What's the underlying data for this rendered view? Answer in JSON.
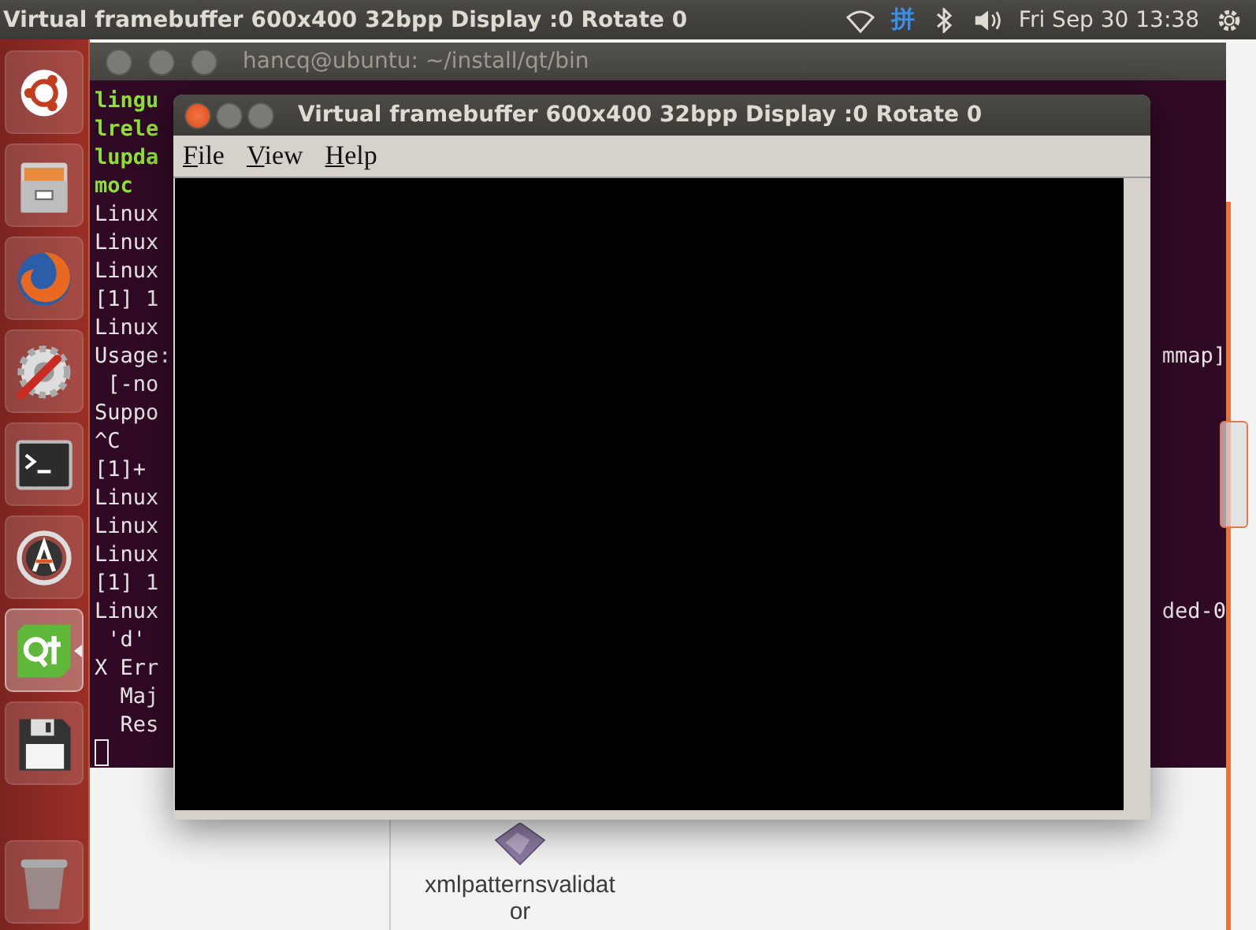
{
  "top_bar": {
    "title": "Virtual framebuffer 600x400 32bpp Display :0 Rotate 0",
    "input_method": "拼",
    "clock": "Fri Sep 30 13:38"
  },
  "launcher": {
    "items": [
      {
        "kind": "ubuntu",
        "selected": false
      },
      {
        "kind": "files",
        "selected": false
      },
      {
        "kind": "firefox",
        "selected": false
      },
      {
        "kind": "settings",
        "selected": false
      },
      {
        "kind": "terminal",
        "selected": false
      },
      {
        "kind": "updater",
        "selected": false
      },
      {
        "kind": "qt",
        "selected": true
      },
      {
        "kind": "save",
        "selected": false
      },
      {
        "kind": "trash",
        "selected": false
      }
    ]
  },
  "terminal": {
    "title": "hancq@ubuntu: ~/install/qt/bin",
    "lines": [
      {
        "kind": "executable",
        "text": "lingu"
      },
      {
        "kind": "executable",
        "text": "lrele"
      },
      {
        "kind": "executable",
        "text": "lupda"
      },
      {
        "kind": "executable",
        "text": "moc"
      },
      {
        "kind": "output",
        "text": "Linux"
      },
      {
        "kind": "output",
        "text": "Linux"
      },
      {
        "kind": "output",
        "text": "Linux"
      },
      {
        "kind": "output",
        "text": "[1] 1"
      },
      {
        "kind": "output",
        "text": "Linux"
      },
      {
        "kind": "output",
        "text": "Usage:",
        "right": "mmap]"
      },
      {
        "kind": "output",
        "text": " [-no"
      },
      {
        "kind": "output",
        "text": "Suppo"
      },
      {
        "kind": "output",
        "text": "^C"
      },
      {
        "kind": "output",
        "text": "[1]+"
      },
      {
        "kind": "output",
        "text": "Linux"
      },
      {
        "kind": "output",
        "text": "Linux"
      },
      {
        "kind": "output",
        "text": "Linux"
      },
      {
        "kind": "output",
        "text": "[1] 1"
      },
      {
        "kind": "output",
        "text": "Linux",
        "right": "ded-0"
      },
      {
        "kind": "output",
        "text": " 'd'"
      },
      {
        "kind": "output",
        "text": "X Err"
      },
      {
        "kind": "output",
        "text": "  Maj"
      },
      {
        "kind": "output",
        "text": "  Res"
      }
    ]
  },
  "file_manager": {
    "items": [
      {
        "label": "xmlpatternsvalidator"
      }
    ]
  },
  "qt_window": {
    "title": "Virtual framebuffer 600x400 32bpp Display :0 Rotate 0",
    "menu": [
      "File",
      "View",
      "Help"
    ]
  }
}
